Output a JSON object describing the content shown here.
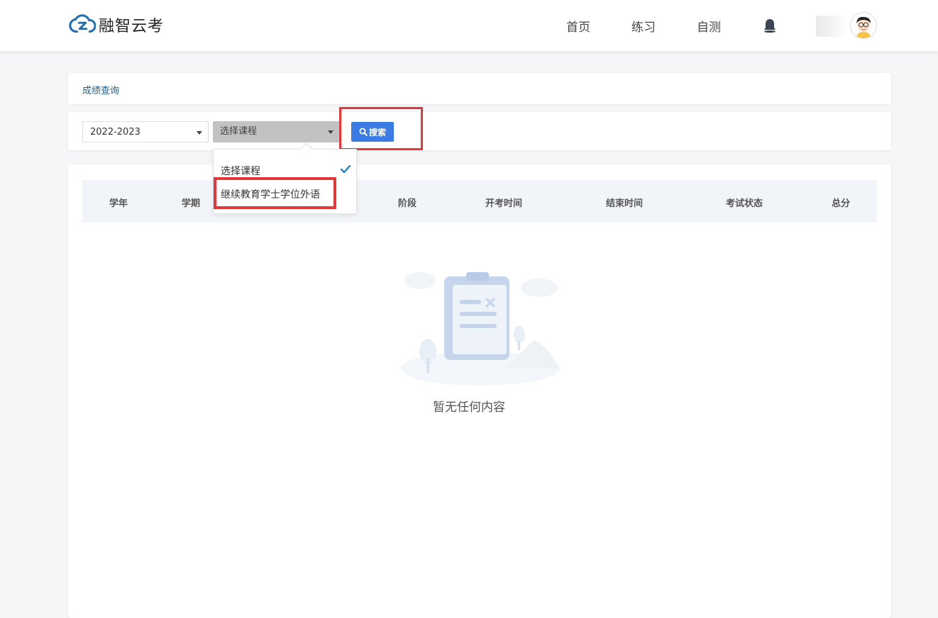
{
  "brand": {
    "name": "融智云考",
    "accent": "#1d6fb8"
  },
  "nav": {
    "items": [
      {
        "label": "首页"
      },
      {
        "label": "练习"
      },
      {
        "label": "自测"
      }
    ]
  },
  "breadcrumb": {
    "label": "成绩查询"
  },
  "filters": {
    "year_value": "2022-2023",
    "course_value": "选择课程",
    "search_label": "搜索",
    "course_options": [
      {
        "label": "选择课程",
        "selected": true
      },
      {
        "label": "继续教育学士学位外语",
        "selected": false
      }
    ]
  },
  "table": {
    "columns": [
      "学年",
      "学期",
      "阶段",
      "开考时间",
      "结束时间",
      "考试状态",
      "总分"
    ],
    "empty_text": "暂无任何内容"
  },
  "colors": {
    "button": "#3b7be5",
    "highlight": "#e43737"
  }
}
